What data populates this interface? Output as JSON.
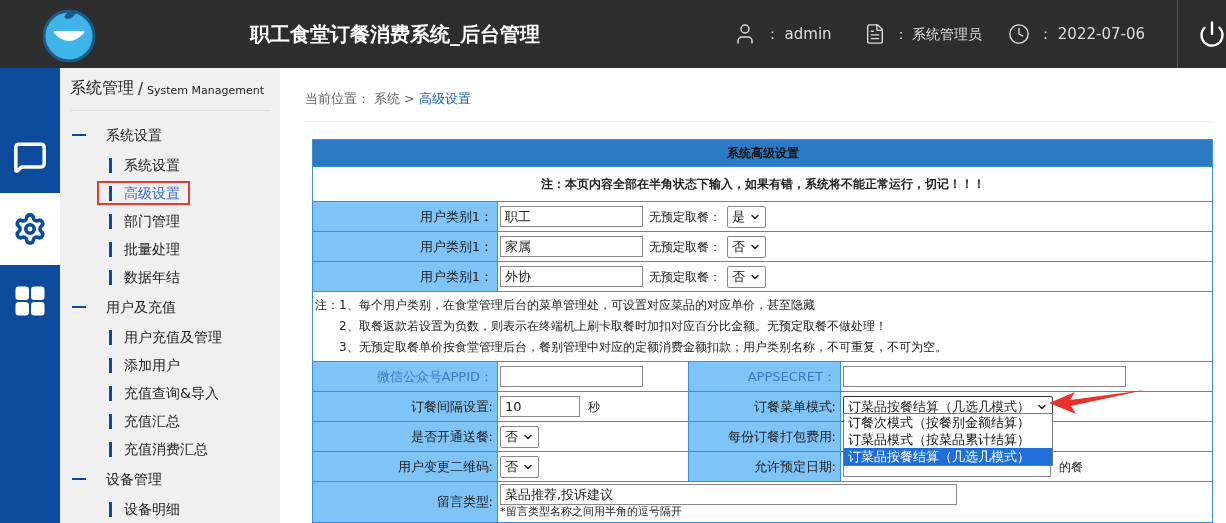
{
  "header": {
    "title": "职工食堂订餐消费系统_后台管理",
    "user": "admin",
    "role": "系统管理员",
    "date": "2022-07-06",
    "separator": "："
  },
  "rail": [
    {
      "selected": false
    },
    {
      "selected": true
    },
    {
      "selected": false
    }
  ],
  "sidebar": {
    "title": "系统管理",
    "slash": "/",
    "subtitle": "System Management",
    "groups": [
      {
        "label": "系统设置",
        "children": [
          {
            "label": "系统设置",
            "selected": false
          },
          {
            "label": "高级设置",
            "selected": true
          },
          {
            "label": "部门管理",
            "selected": false
          },
          {
            "label": "批量处理",
            "selected": false
          },
          {
            "label": "数据年结",
            "selected": false
          }
        ]
      },
      {
        "label": "用户及充值",
        "children": [
          {
            "label": "用户充值及管理",
            "selected": false
          },
          {
            "label": "添加用户",
            "selected": false
          },
          {
            "label": "充值查询&导入",
            "selected": false
          },
          {
            "label": "充值汇总",
            "selected": false
          },
          {
            "label": "充值消费汇总",
            "selected": false
          }
        ]
      },
      {
        "label": "设备管理",
        "children": [
          {
            "label": "设备明细",
            "selected": false
          }
        ]
      }
    ]
  },
  "breadcrumb": {
    "prefix": "当前位置：",
    "items": [
      {
        "label": "系统",
        "current": false
      },
      {
        "label": "高级设置",
        "current": true
      }
    ],
    "separator": ">"
  },
  "panel": {
    "title": "系统高级设置",
    "warning": "注：本页内容全部在半角状态下输入，如果有错，系统将不能正常运行，切记！！！",
    "categories": [
      {
        "label": "用户类别1：",
        "value": "职工",
        "meal_label": "无预定取餐：",
        "meal_value": "是"
      },
      {
        "label": "用户类别1：",
        "value": "家属",
        "meal_label": "无预定取餐：",
        "meal_value": "否"
      },
      {
        "label": "用户类别1：",
        "value": "外协",
        "meal_label": "无预定取餐：",
        "meal_value": "否"
      }
    ],
    "notes": [
      "注：1、每个用户类别，在食堂管理后台的菜单管理处，可设置对应菜品的对应单价，甚至隐藏",
      "2、取餐返款若设置为负数，则表示在终端机上刷卡取餐时加扣对应百分比金额。无预定取餐不做处理！",
      "3、无预定取餐单价按食堂管理后台，餐别管理中对应的定额消费金额扣款；用户类别名称，不可重复，不可为空。"
    ],
    "rows": [
      {
        "cells": [
          {
            "label": "微信公众号APPID：",
            "accent": true,
            "kind": "input"
          },
          {
            "label": "APPSECRET：",
            "accent": true,
            "kind": "input"
          }
        ]
      },
      {
        "cells": [
          {
            "label": "订餐间隔设置:",
            "accent": false,
            "kind": "input",
            "value": "10",
            "unit": "秒"
          },
          {
            "label": "订餐菜单模式:",
            "accent": false,
            "kind": "select",
            "value": "订菜品按餐结算（几选几模式）",
            "open": true,
            "options": [
              {
                "label": "订餐次模式（按餐别金额结算）",
                "selected": false
              },
              {
                "label": "订菜品模式（按菜品累计结算）",
                "selected": false
              },
              {
                "label": "订菜品按餐结算（几选几模式）",
                "selected": true
              }
            ]
          }
        ]
      },
      {
        "cells": [
          {
            "label": "是否开通送餐:",
            "accent": false,
            "kind": "select",
            "value": "否"
          },
          {
            "label": "每份订餐打包费用:",
            "accent": false,
            "kind": "hidden"
          }
        ]
      },
      {
        "cells": [
          {
            "label": "用户变更二维码:",
            "accent": false,
            "kind": "select",
            "value": "否"
          },
          {
            "label": "允许预定日期:",
            "accent": false,
            "kind": "input",
            "unit": "的餐"
          }
        ]
      }
    ],
    "message": {
      "label": "留言类型:",
      "value": "菜品推荐,投诉建议",
      "hint": "*留言类型名称之间用半角的逗号隔开"
    }
  }
}
